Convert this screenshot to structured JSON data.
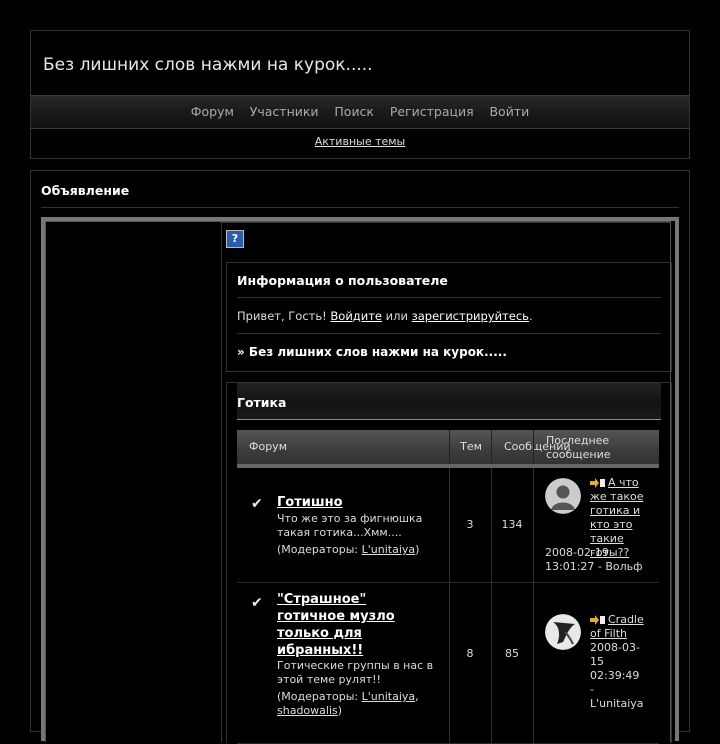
{
  "header": {
    "title": "Без лишних слов нажми на курок.....",
    "nav": [
      "Форум",
      "Участники",
      "Поиск",
      "Регистрация",
      "Войти"
    ],
    "sub_link": "Активные темы"
  },
  "announcement": {
    "title": "Объявление"
  },
  "userinfo": {
    "title": "Информация о пользователе",
    "greet_prefix": "Привет, Гость! ",
    "login": "Войдите",
    "or": " или ",
    "register": "зарегистрируйтесь",
    "dot": ".",
    "board_link": "» Без лишних слов нажми на курок....."
  },
  "category": {
    "title": "Готика"
  },
  "table_headers": {
    "forum": "Форум",
    "topics": "Тем",
    "posts": "Сообщений",
    "last": "Последнее сообщение"
  },
  "forums": [
    {
      "name": "Готишно",
      "desc": "Что же это за фигнюшка такая готика...Хмм....",
      "mods_prefix": "(Модераторы: ",
      "mods": [
        "L'unitaiya"
      ],
      "mods_suffix": ")",
      "topics": "3",
      "posts": "134",
      "last_title": "А что же такое готика и кто это такие готы??",
      "last_date": "2008-02-19 13:01:27 - Вольф"
    },
    {
      "name": "\"Страшное\" готичное музло только для ибранных!!",
      "desc": "Готические группы в нас в этой теме рулят!!",
      "mods_prefix": "(Модераторы: ",
      "mods": [
        "L'unitaiya",
        "shadowalis"
      ],
      "mods_suffix": ")",
      "topics": "8",
      "posts": "85",
      "last_title": "Cradle of Filth",
      "last_date": "2008-03-15 02:39:49 - L'unitaiya"
    }
  ],
  "icons": {
    "help": "help-icon",
    "check": "checkmark-icon",
    "last_post": "arrow-doc-icon",
    "avatar": "user-avatar-icon"
  }
}
